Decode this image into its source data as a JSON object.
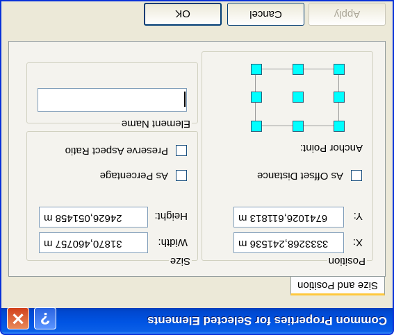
{
  "window": {
    "title": "Common Properties for Selected Elements",
    "help_symbol": "?",
    "close_symbol": "✕"
  },
  "tabs": [
    {
      "label": "Size and Position",
      "selected": true
    }
  ],
  "position": {
    "group_label": "Position",
    "x_label": "X:",
    "x_value": "3333268,241536 m",
    "y_label": "Y:",
    "y_value": "6741026,611813 m",
    "as_offset_label": "As Offset Distance",
    "as_offset_checked": false,
    "anchor_label": "Anchor Point:",
    "anchor_handle_color": "#00ffff"
  },
  "element_name": {
    "group_label": "Element Name",
    "value": ""
  },
  "size": {
    "group_label": "Size",
    "width_label": "Width:",
    "width_value": "31870,460757 m",
    "height_label": "Height:",
    "height_value": "24626,051458 m",
    "as_percentage_label": "As Percentage",
    "as_percentage_checked": false,
    "preserve_label": "Preserve Aspect Ratio",
    "preserve_checked": false
  },
  "buttons": {
    "ok": "OK",
    "cancel": "Cancel",
    "apply": "Apply"
  },
  "colors": {
    "titlebar": "#0054e3",
    "dialog_bg": "#ece9d8",
    "close_button": "#d2421c",
    "anchor_handle": "#00ffff"
  }
}
